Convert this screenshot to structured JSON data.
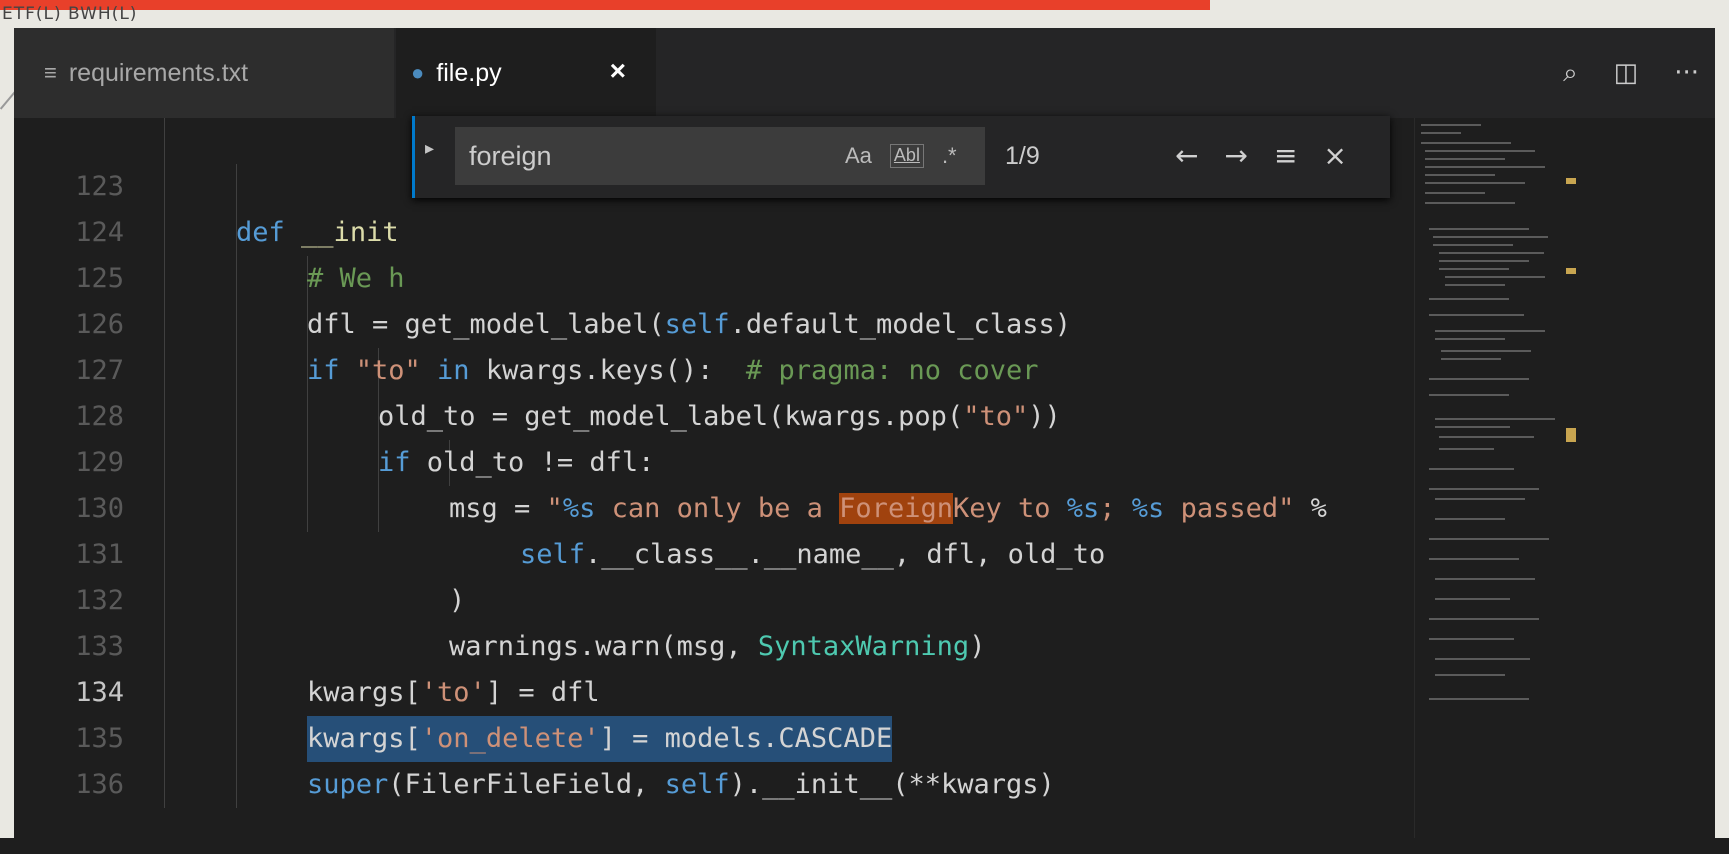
{
  "top_strip": {
    "menu_text": "ETF(L)   BWH(L)"
  },
  "tabs": [
    {
      "icon": "≡",
      "label": "requirements.txt"
    },
    {
      "icon": "●",
      "label": "file.py",
      "close": "×"
    }
  ],
  "tab_actions": {
    "open_preview": "⌕",
    "split": "◫",
    "more": "···"
  },
  "find": {
    "toggle": "▸",
    "query": "foreign",
    "match_case": "Aa",
    "whole_word": "Abl",
    "regex": ".*",
    "count": "1/9",
    "prev": "←",
    "next": "→",
    "in_selection": "≡",
    "close": "×"
  },
  "code": {
    "active_line": "134",
    "lines": [
      {
        "n": "123"
      },
      {
        "n": "124"
      },
      {
        "n": "125"
      },
      {
        "n": "126"
      },
      {
        "n": "127"
      },
      {
        "n": "128"
      },
      {
        "n": "129"
      },
      {
        "n": "130"
      },
      {
        "n": "131"
      },
      {
        "n": "132"
      },
      {
        "n": "133"
      },
      {
        "n": "134"
      },
      {
        "n": "135"
      },
      {
        "n": "136"
      }
    ],
    "l123": {
      "kw": "def",
      "rest": "__init"
    },
    "l124": {
      "comment": "# We h"
    },
    "l125": {
      "a": "dfl = get_model_label(",
      "b": "self",
      "c": ".default_model_class)"
    },
    "l126": {
      "a": "if",
      "b": " \"to\"",
      "c": " in",
      "d": " kwargs.keys():",
      "e": "  # pragma: no cover"
    },
    "l127": {
      "a": "old_to = get_model_label(kwargs.pop(",
      "b": "\"to\"",
      "c": "))"
    },
    "l128": {
      "a": "if",
      "b": " old_to != dfl:"
    },
    "l129": {
      "a": "msg = ",
      "b": "\"",
      "c": "%s",
      "d": " can only be a ",
      "e": "Foreign",
      "f": "Key to ",
      "g": "%s",
      "h": "; ",
      "i": "%s",
      "j": " passed\"",
      "k": " %"
    },
    "l130": {
      "a": "self",
      "b": ".__class__.__name__, dfl, old_to"
    },
    "l131": {
      "a": ")"
    },
    "l132": {
      "a": "warnings.warn(msg, ",
      "b": "SyntaxWarning",
      "c": ")"
    },
    "l133": {
      "a": "kwargs[",
      "b": "'to'",
      "c": "] = dfl"
    },
    "l134": {
      "a": "kwargs[",
      "b": "'on_delete'",
      "c": "] = models.CASCADE"
    },
    "l135": {
      "a": "super",
      "b": "(FilerFileField, ",
      "c": "self",
      "d": ").__init__(**kwargs)"
    }
  },
  "colors": {
    "background": "#1e1e1e",
    "keyword": "#569cd6",
    "string": "#ce9178",
    "comment": "#6a9955",
    "class": "#4ec9b0",
    "find_match": "#a0420e",
    "selection": "#264f78"
  }
}
